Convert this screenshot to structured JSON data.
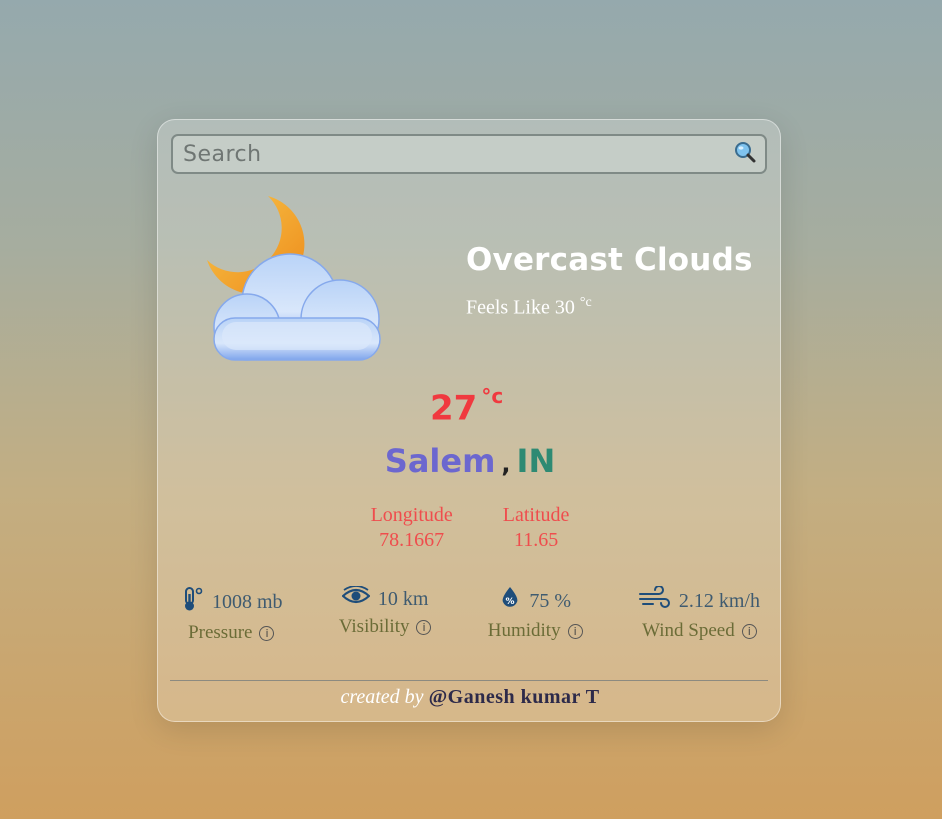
{
  "search": {
    "placeholder": "Search",
    "icon": "magnifier-icon"
  },
  "weather": {
    "icon": "moon-cloud-icon",
    "condition": "Overcast Clouds",
    "feels_label": "Feels Like 30",
    "feels_unit": "°c",
    "temperature": "27",
    "temp_unit": "°c"
  },
  "location": {
    "city": "Salem",
    "separator": ",",
    "country": "IN"
  },
  "coords": {
    "longitude_label": "Longitude",
    "longitude": "78.1667",
    "latitude_label": "Latitude",
    "latitude": "11.65"
  },
  "stats": [
    {
      "icon": "thermometer-icon",
      "value": "1008 mb",
      "label": "Pressure"
    },
    {
      "icon": "eye-icon",
      "value": "10 km",
      "label": "Visibility"
    },
    {
      "icon": "humidity-drop-icon",
      "value": "75 %",
      "label": "Humidity"
    },
    {
      "icon": "wind-icon",
      "value": "2.12 km/h",
      "label": "Wind Speed"
    }
  ],
  "info_glyph": "i",
  "footer": {
    "created_by": "created by",
    "author": "@Ganesh kumar T"
  },
  "colors": {
    "temperature": "#f0393f",
    "city": "#6c67cf",
    "country": "#2e8a73",
    "coords": "#ef4d4d",
    "stat_value": "#3f5b70",
    "stat_label": "#6b6c37"
  }
}
